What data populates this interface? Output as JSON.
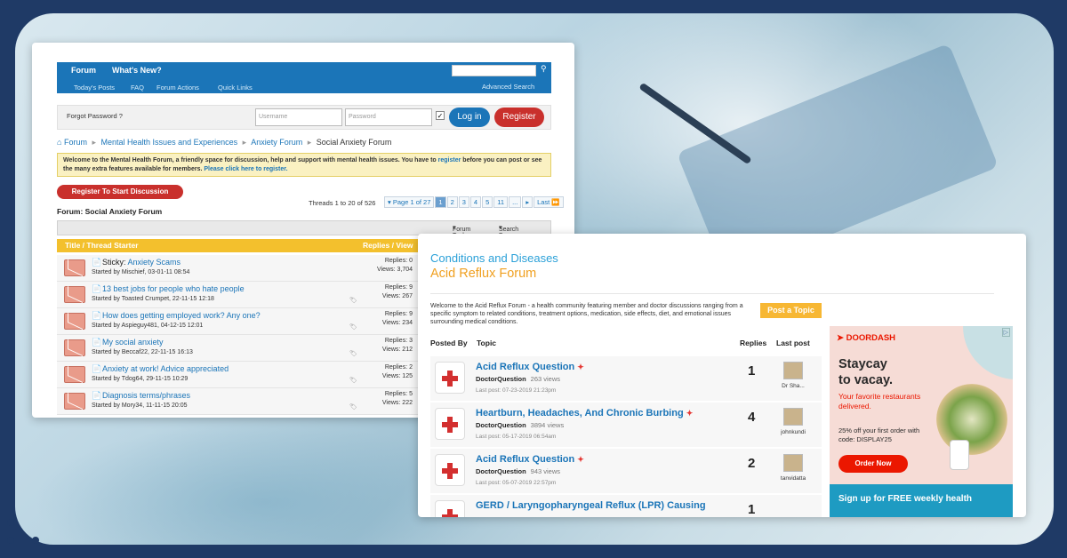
{
  "forum_panel": {
    "nav": {
      "forum": "Forum",
      "whats_new": "What's New?",
      "todays_posts": "Today's Posts",
      "faq": "FAQ",
      "forum_actions": "Forum Actions",
      "quick_links": "Quick Links",
      "advanced_search": "Advanced Search"
    },
    "login": {
      "forgot": "Forgot Password ?",
      "username_placeholder": "Username",
      "password_placeholder": "Password",
      "login_label": "Log in",
      "register_label": "Register"
    },
    "breadcrumb": [
      "Forum",
      "Mental Health Issues and Experiences",
      "Anxiety Forum",
      "Social Anxiety Forum"
    ],
    "notice": {
      "text1": "Welcome to the Mental Health Forum, a friendly space for discussion, help and support with mental health issues. You have to",
      "link1": "register",
      "text2": "before you can post or see the many extra features available for members.",
      "link2": "Please click here to register."
    },
    "register_discussion": "Register To Start Discussion",
    "threads_count": "Threads 1 to 20 of 526",
    "pager": [
      "Page 1 of 27",
      "1",
      "2",
      "3",
      "4",
      "5",
      "11",
      "...",
      "Last"
    ],
    "forum_title": "Forum: Social Anxiety Forum",
    "tools": {
      "forum_tools": "Forum Tools",
      "search_forum": "Search Forum"
    },
    "header": {
      "title": "Title / Thread Starter",
      "replies": "Replies / View"
    },
    "threads": [
      {
        "sticky": "Sticky:",
        "title": "Anxiety Scams",
        "starter": "Started by Mischief, 03-01-11 08:54",
        "replies": "Replies: 0",
        "views": "Views: 3,704"
      },
      {
        "sticky": "",
        "title": "13 best jobs for people who hate people",
        "starter": "Started by Toasted Crumpet, 22-11-15 12:18",
        "replies": "Replies: 9",
        "views": "Views: 267"
      },
      {
        "sticky": "",
        "title": "How does getting employed work? Any one?",
        "starter": "Started by Aspieguy481, 04-12-15 12:01",
        "replies": "Replies: 9",
        "views": "Views: 234"
      },
      {
        "sticky": "",
        "title": "My social anxiety",
        "starter": "Started by Beccaf22, 22-11-15 16:13",
        "replies": "Replies: 3",
        "views": "Views: 212"
      },
      {
        "sticky": "",
        "title": "Anxiety at work! Advice appreciated",
        "starter": "Started by Tdog64, 29-11-15 10:29",
        "replies": "Replies: 2",
        "views": "Views: 125"
      },
      {
        "sticky": "",
        "title": "Diagnosis terms/phrases",
        "starter": "Started by Mory34, 11-11-15 20:05",
        "replies": "Replies: 5",
        "views": "Views: 222"
      }
    ]
  },
  "reflux_panel": {
    "category": "Conditions and Diseases",
    "forum": "Acid Reflux Forum",
    "description": "Welcome to the Acid Reflux Forum - a health community featuring member and doctor discussions ranging from a specific symptom to related conditions, treatment options, medication, side effects, diet, and emotional issues surrounding medical conditions.",
    "post_topic": "Post a Topic",
    "columns": {
      "posted_by": "Posted By",
      "topic": "Topic",
      "replies": "Replies",
      "last_post": "Last post"
    },
    "topics": [
      {
        "title": "Acid Reflux Question",
        "author": "DoctorQuestion",
        "views": "263 views",
        "date": "Last post: 07-23-2019 21:23pm",
        "replies": "1",
        "last_user": "Dr Sha..."
      },
      {
        "title": "Heartburn, Headaches, And Chronic Burbing",
        "author": "DoctorQuestion",
        "views": "3894 views",
        "date": "Last post: 05-17-2019 06:54am",
        "replies": "4",
        "last_user": "johnkundi"
      },
      {
        "title": "Acid Reflux Question",
        "author": "DoctorQuestion",
        "views": "943 views",
        "date": "Last post: 05-07-2019 22:57pm",
        "replies": "2",
        "last_user": "tanvidatta"
      },
      {
        "title": "GERD / Laryngopharyngeal Reflux (LPR) Causing",
        "author": "",
        "views": "",
        "date": "",
        "replies": "1",
        "last_user": ""
      }
    ],
    "ad": {
      "brand": "DOORDASH",
      "headline1": "Staycay",
      "headline2": "to vacay.",
      "sub": "Your favorite restaurants delivered.",
      "promo": "25% off your first order with code: DISPLAY25",
      "cta": "Order Now",
      "banner": "Sign up for FREE weekly health"
    }
  }
}
